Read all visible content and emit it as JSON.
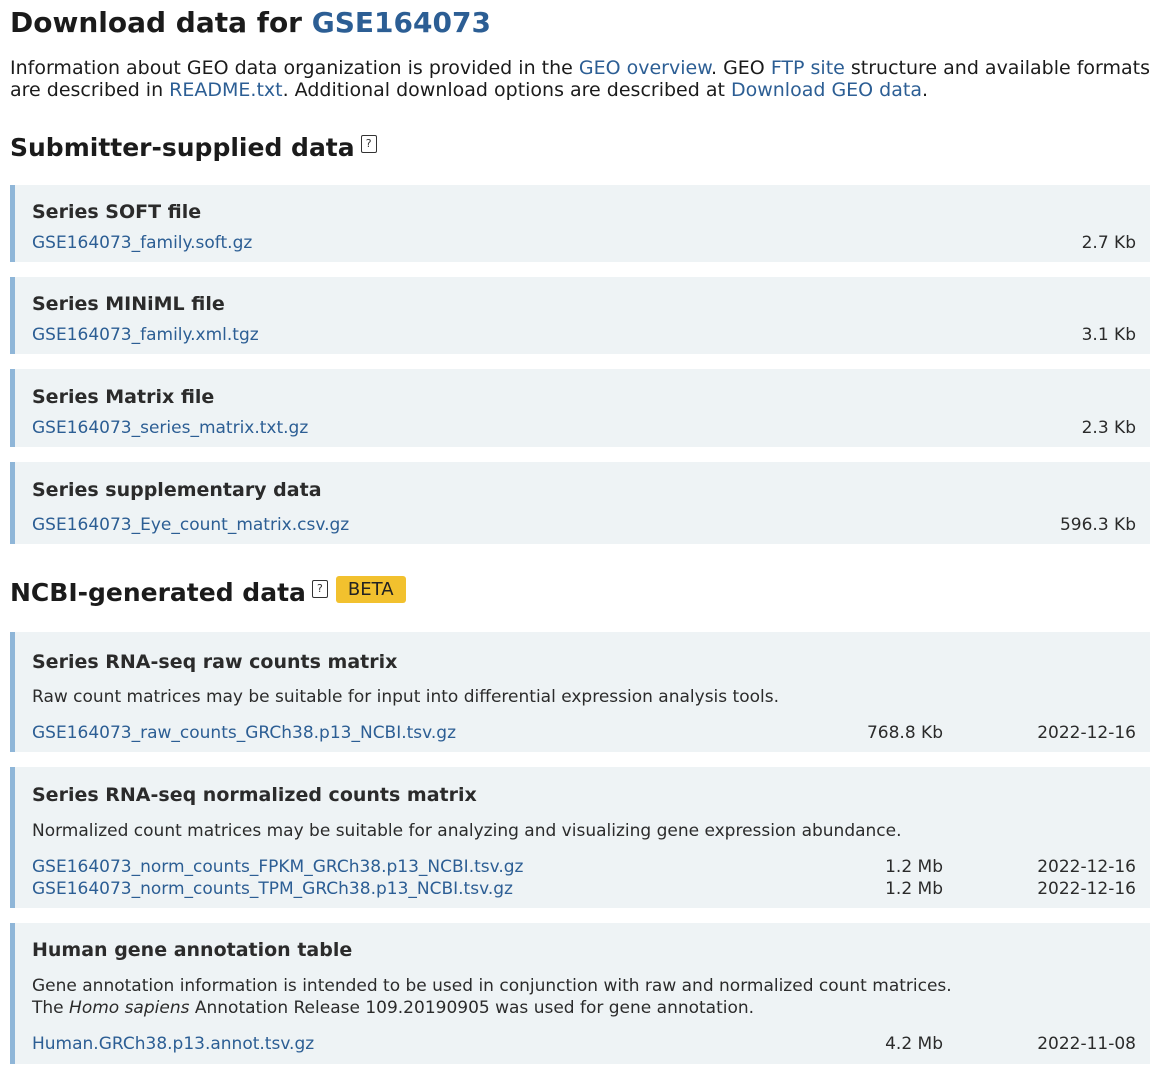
{
  "header": {
    "title_prefix": "Download data for",
    "accession": "GSE164073"
  },
  "intro": {
    "t1": "Information about GEO data organization is provided in the",
    "link_overview": "GEO overview",
    "t2": ". GEO",
    "link_ftp": "FTP site",
    "t3": "structure and available formats are described in",
    "link_readme": "README.txt",
    "t4": ". Additional download options are described at",
    "link_download": "Download GEO data",
    "t5": "."
  },
  "submitter": {
    "title": "Submitter-supplied data",
    "help": "?",
    "boxes": [
      {
        "title": "Series SOFT file",
        "file": "GSE164073_family.soft.gz",
        "size": "2.7 Kb"
      },
      {
        "title": "Series MINiML file",
        "file": "GSE164073_family.xml.tgz",
        "size": "3.1 Kb"
      },
      {
        "title": "Series Matrix file",
        "file": "GSE164073_series_matrix.txt.gz",
        "size": "2.3 Kb"
      },
      {
        "title": "Series supplementary data",
        "file": "GSE164073_Eye_count_matrix.csv.gz",
        "size": "596.3 Kb"
      }
    ]
  },
  "ncbi": {
    "title": "NCBI-generated data",
    "help": "?",
    "badge": "BETA",
    "boxes": [
      {
        "title": "Series RNA-seq raw counts matrix",
        "desc": "Raw count matrices may be suitable for input into differential expression analysis tools.",
        "files": [
          {
            "name": "GSE164073_raw_counts_GRCh38.p13_NCBI.tsv.gz",
            "size": "768.8 Kb",
            "date": "2022-12-16"
          }
        ]
      },
      {
        "title": "Series RNA-seq normalized counts matrix",
        "desc": "Normalized count matrices may be suitable for analyzing and visualizing gene expression abundance.",
        "files": [
          {
            "name": "GSE164073_norm_counts_FPKM_GRCh38.p13_NCBI.tsv.gz",
            "size": "1.2 Mb",
            "date": "2022-12-16"
          },
          {
            "name": "GSE164073_norm_counts_TPM_GRCh38.p13_NCBI.tsv.gz",
            "size": "1.2 Mb",
            "date": "2022-12-16"
          }
        ]
      },
      {
        "title": "Human gene annotation table",
        "desc": "Gene annotation information is intended to be used in conjunction with raw and normalized count matrices.",
        "desc2_pre": "The",
        "desc2_species": "Homo sapiens",
        "desc2_post": "Annotation Release 109.20190905 was used for gene annotation.",
        "files": [
          {
            "name": "Human.GRCh38.p13.annot.tsv.gz",
            "size": "4.2 Mb",
            "date": "2022-11-08"
          }
        ]
      }
    ]
  }
}
